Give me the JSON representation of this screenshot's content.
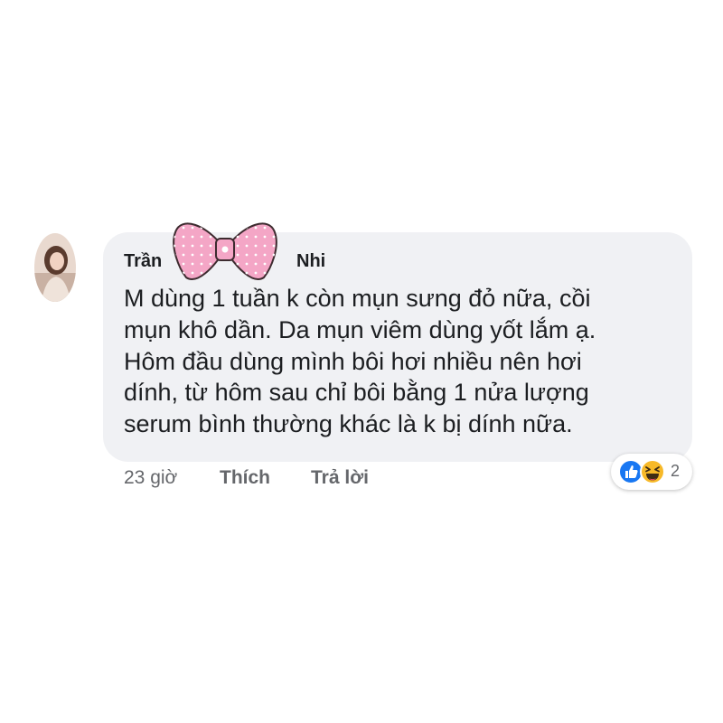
{
  "comment": {
    "author_first": "Trần",
    "author_last": "Nhi",
    "lines": [
      "M dùng 1 tuần k còn mụn sưng đỏ nữa, cồi",
      "mụn khô dần. Da mụn viêm dùng yốt lắm ạ.",
      "Hôm đầu dùng mình bôi hơi nhiều nên hơi",
      "dính, từ hôm sau chỉ bôi bằng 1 nửa lượng",
      "serum bình thường khác là k bị dính nữa."
    ]
  },
  "meta": {
    "time": "23 giờ",
    "like_label": "Thích",
    "reply_label": "Trả lời"
  },
  "reactions": {
    "icons": [
      "like-icon",
      "haha-icon"
    ],
    "count": "2"
  },
  "colors": {
    "bubble": "#f0f1f4",
    "meta_text": "#65676b",
    "like_blue": "#1877f2",
    "haha_yellow": "#f7b928",
    "bow_pink": "#f4a6c6"
  }
}
